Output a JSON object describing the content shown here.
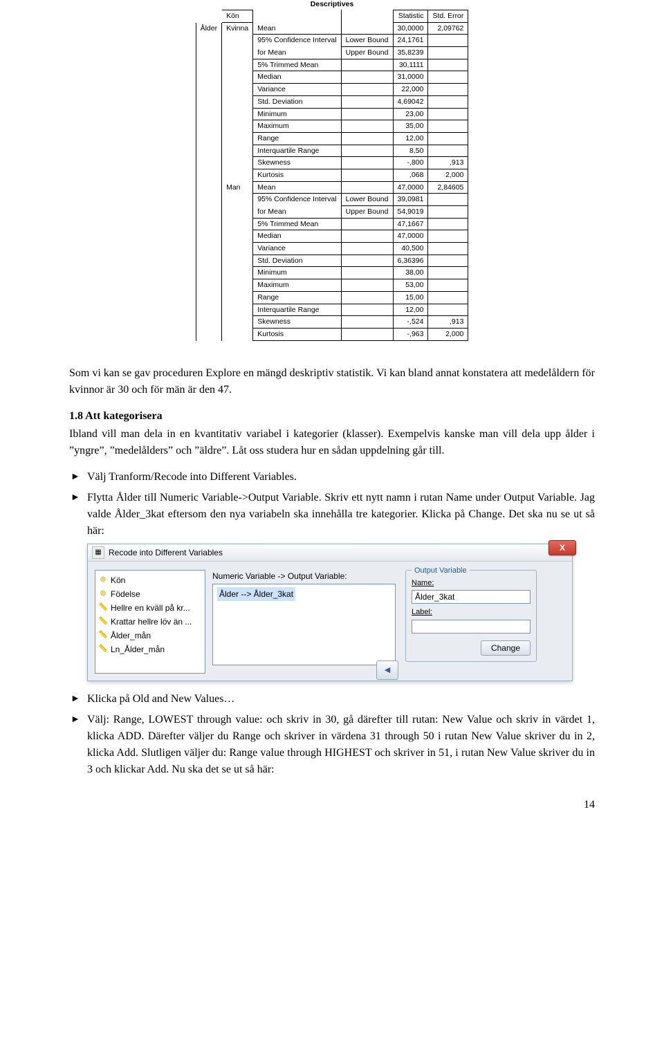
{
  "desc": {
    "title": "Descriptives",
    "headers": {
      "kon": "Kön",
      "stat": "Statistic",
      "stderr": "Std. Error"
    },
    "var": "Ålder",
    "groups": [
      {
        "name": "Kvinna",
        "rows": [
          {
            "label": "Mean",
            "sub": "",
            "stat": "30,0000",
            "stderr": "2,09762"
          },
          {
            "label": "95% Confidence Interval",
            "sub": "Lower Bound",
            "stat": "24,1761",
            "stderr": "",
            "cont": true
          },
          {
            "label": "for Mean",
            "sub": "Upper Bound",
            "stat": "35,8239",
            "stderr": ""
          },
          {
            "label": "5% Trimmed Mean",
            "sub": "",
            "stat": "30,1111",
            "stderr": ""
          },
          {
            "label": "Median",
            "sub": "",
            "stat": "31,0000",
            "stderr": ""
          },
          {
            "label": "Variance",
            "sub": "",
            "stat": "22,000",
            "stderr": ""
          },
          {
            "label": "Std. Deviation",
            "sub": "",
            "stat": "4,69042",
            "stderr": ""
          },
          {
            "label": "Minimum",
            "sub": "",
            "stat": "23,00",
            "stderr": ""
          },
          {
            "label": "Maximum",
            "sub": "",
            "stat": "35,00",
            "stderr": ""
          },
          {
            "label": "Range",
            "sub": "",
            "stat": "12,00",
            "stderr": ""
          },
          {
            "label": "Interquartile Range",
            "sub": "",
            "stat": "8,50",
            "stderr": ""
          },
          {
            "label": "Skewness",
            "sub": "",
            "stat": "-,800",
            "stderr": ",913"
          },
          {
            "label": "Kurtosis",
            "sub": "",
            "stat": ",068",
            "stderr": "2,000"
          }
        ]
      },
      {
        "name": "Man",
        "rows": [
          {
            "label": "Mean",
            "sub": "",
            "stat": "47,0000",
            "stderr": "2,84605"
          },
          {
            "label": "95% Confidence Interval",
            "sub": "Lower Bound",
            "stat": "39,0981",
            "stderr": "",
            "cont": true
          },
          {
            "label": "for Mean",
            "sub": "Upper Bound",
            "stat": "54,9019",
            "stderr": ""
          },
          {
            "label": "5% Trimmed Mean",
            "sub": "",
            "stat": "47,1667",
            "stderr": ""
          },
          {
            "label": "Median",
            "sub": "",
            "stat": "47,0000",
            "stderr": ""
          },
          {
            "label": "Variance",
            "sub": "",
            "stat": "40,500",
            "stderr": ""
          },
          {
            "label": "Std. Deviation",
            "sub": "",
            "stat": "6,36396",
            "stderr": ""
          },
          {
            "label": "Minimum",
            "sub": "",
            "stat": "38,00",
            "stderr": ""
          },
          {
            "label": "Maximum",
            "sub": "",
            "stat": "53,00",
            "stderr": ""
          },
          {
            "label": "Range",
            "sub": "",
            "stat": "15,00",
            "stderr": ""
          },
          {
            "label": "Interquartile Range",
            "sub": "",
            "stat": "12,00",
            "stderr": ""
          },
          {
            "label": "Skewness",
            "sub": "",
            "stat": "-,524",
            "stderr": ",913"
          },
          {
            "label": "Kurtosis",
            "sub": "",
            "stat": "-,963",
            "stderr": "2,000"
          }
        ]
      }
    ]
  },
  "para1": "Som vi kan se gav proceduren Explore en mängd deskriptiv statistik. Vi kan bland annat konstatera att medelåldern för kvinnor är 30 och för män är den 47.",
  "sec": "1.8 Att kategorisera",
  "para2": "Ibland vill man dela in en kvantitativ variabel i kategorier (klasser). Exempelvis kanske man vill dela upp ålder i ”yngre”, ”medelålders” och ”äldre”. Låt oss studera hur en sådan uppdelning går till.",
  "bulletsA": [
    "Välj Tranform/Recode into Different Variables.",
    "Flytta Ålder till Numeric Variable->Output Variable. Skriv ett nytt namn i rutan Name under Output Variable. Jag valde Ålder_3kat eftersom den nya variabeln ska innehålla tre kategorier. Klicka på Change. Det ska nu se ut så här:"
  ],
  "dlg": {
    "title": "Recode into Different Variables",
    "close": "X",
    "vars": [
      {
        "name": "Kön",
        "type": "nom"
      },
      {
        "name": "Födelse",
        "type": "nom"
      },
      {
        "name": "Hellre en kväll på kr...",
        "type": "sca"
      },
      {
        "name": "Krattar hellre löv än ...",
        "type": "sca"
      },
      {
        "name": "Ålder_mån",
        "type": "sca"
      },
      {
        "name": "Ln_Ålder_mån",
        "type": "sca"
      }
    ],
    "midLabel": "Numeric Variable -> Output Variable:",
    "midValue": "Ålder --> Ålder_3kat",
    "out": {
      "legend": "Output Variable",
      "nameLabel": "Name:",
      "nameValue": "Ålder_3kat",
      "labelLabel": "Label:",
      "labelValue": "",
      "changeBtn": "Change"
    },
    "arrow": "◄"
  },
  "bulletsB": [
    "Klicka på Old and New Values…",
    "Välj: Range, LOWEST through value: och skriv in 30, gå därefter till rutan: New Value och skriv in värdet 1, klicka ADD. Därefter väljer du Range och skriver in värdena 31 through 50 i rutan New Value skriver du in 2, klicka Add. Slutligen väljer du: Range value through HIGHEST och skriver in 51, i rutan New Value skriver du in 3 och klickar Add. Nu ska det se ut så här:"
  ],
  "pagenum": "14"
}
